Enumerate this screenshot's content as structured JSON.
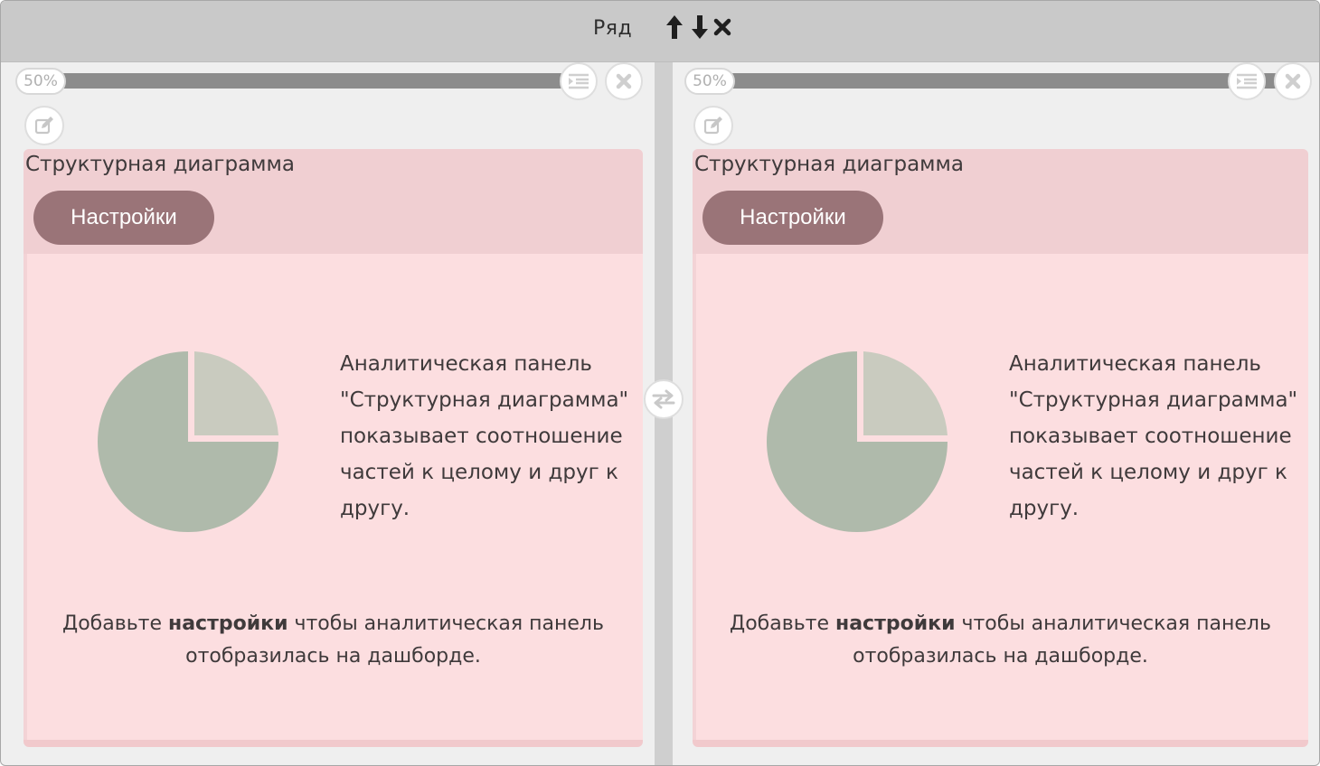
{
  "row": {
    "title": "Ряд",
    "controls": [
      "arrow-up-icon",
      "arrow-down-icon",
      "close-icon"
    ]
  },
  "columns": [
    {
      "width_label": "50%",
      "width_fraction": 0.5,
      "widget": {
        "title": "Структурная диаграмма",
        "settings_label": "Настройки",
        "description": "Аналитическая панель \"Структурная диаграмма\" показывает соотношение частей к целому и друг к другу.",
        "hint_prefix": "Добавьте ",
        "hint_bold": "настройки",
        "hint_suffix": " чтобы аналитическая панель отобразилась на дашборде."
      }
    },
    {
      "width_label": "50%",
      "width_fraction": 0.5,
      "widget": {
        "title": "Структурная диаграмма",
        "settings_label": "Настройки",
        "description": "Аналитическая панель \"Структурная диаграмма\" показывает соотношение частей к целому и друг к другу.",
        "hint_prefix": "Добавьте ",
        "hint_bold": "настройки",
        "hint_suffix": " чтобы аналитическая панель отобразилась на дашборде."
      }
    }
  ],
  "icons": {
    "column_menu": "list-indent-icon",
    "column_remove": "close-icon",
    "widget_edit": "edit-icon",
    "swap_columns": "swap-icon"
  },
  "colors": {
    "header_bg": "#c9c9c9",
    "panel_bg": "#fcdee0",
    "panel_head_bg": "#f0cfd2",
    "settings_button": "#9a7478",
    "pie_major": "#afbaab",
    "pie_minor": "#c9cbbf"
  }
}
